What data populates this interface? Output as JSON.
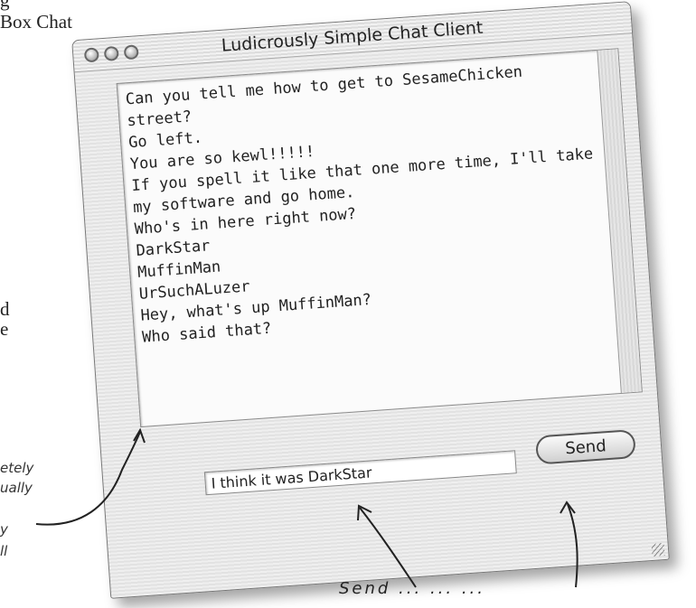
{
  "background_text": {
    "line1": "g",
    "line2": " Box Chat",
    "line3": "d",
    "line4": "e"
  },
  "annotations": {
    "note1": "etely",
    "note2": "ually",
    "note3": "y",
    "note4": "ll",
    "bottom": "Send ... ... ..."
  },
  "window": {
    "title": "Ludicrously Simple Chat Client",
    "buttons": [
      "close",
      "minimize",
      "zoom"
    ]
  },
  "chat": {
    "lines": [
      "Can you tell me how to get to SesameChicken",
      "street?",
      "Go left.",
      "You are so kewl!!!!!",
      "If you spell it like that one more time, I'll take",
      "my software and go home.",
      "Who's in here right now?",
      "DarkStar",
      "MuffinMan",
      "UrSuchALuzer",
      "Hey, what's up MuffinMan?",
      "Who said that?"
    ]
  },
  "input": {
    "value": "I think it was DarkStar"
  },
  "send_button": {
    "label": "Send"
  }
}
